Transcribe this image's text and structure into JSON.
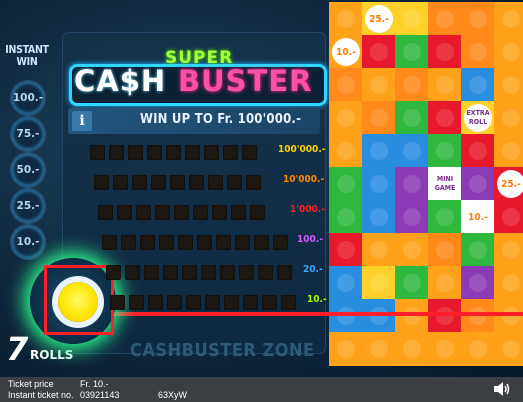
{
  "instant_win": {
    "title_line1": "INSTANT",
    "title_line2": "WIN",
    "values": [
      "100.-",
      "75.-",
      "50.-",
      "25.-",
      "10.-"
    ]
  },
  "logo": {
    "super": "SUPER",
    "cash": "CA$H",
    "buster": "BUSTER"
  },
  "info": {
    "icon": "i",
    "win_up_to": "WIN UP TO Fr. 100'000.-"
  },
  "prizes": [
    {
      "label": "100'000.-",
      "color": "#ffd200"
    },
    {
      "label": "10'000.-",
      "color": "#ff8a00"
    },
    {
      "label": "1'000.-",
      "color": "#ff2020"
    },
    {
      "label": "100.-",
      "color": "#d35bff"
    },
    {
      "label": "20.-",
      "color": "#3aa8ff"
    },
    {
      "label": "10.-",
      "color": "#a8ff00"
    }
  ],
  "zone": "CASHBUSTER ZONE",
  "rolls": {
    "count": "7",
    "label": "ROLLS"
  },
  "grid_tokens": [
    {
      "col": 1,
      "row": 0,
      "text": "25.-"
    },
    {
      "col": 0,
      "row": 1,
      "text": "10.-"
    },
    {
      "col": 4,
      "row": 3,
      "text": "EXTRA ROLL"
    },
    {
      "col": 3,
      "row": 5,
      "text": "MINI GAME"
    },
    {
      "col": 5,
      "row": 5,
      "text": "25.-"
    },
    {
      "col": 4,
      "row": 6,
      "text": "10.-"
    }
  ],
  "grid_colors": [
    [
      "#ffa21a",
      "#ffd12a",
      "#ffd12a",
      "#ff8a1a",
      "#ff8a1a",
      "#ffa21a"
    ],
    [
      "#ffa21a",
      "#e8192c",
      "#2fb83e",
      "#e8192c",
      "#ff8a1a",
      "#ffa21a"
    ],
    [
      "#ff8a1a",
      "#ffa21a",
      "#ff8a1a",
      "#ffa21a",
      "#2a8ee0",
      "#ffa21a"
    ],
    [
      "#ffa21a",
      "#ff8a1a",
      "#2fb83e",
      "#e8192c",
      "#ffd12a",
      "#ffa21a"
    ],
    [
      "#ffa21a",
      "#2a8ee0",
      "#2a8ee0",
      "#2fb83e",
      "#e8192c",
      "#ffa21a"
    ],
    [
      "#2fb83e",
      "#2a8ee0",
      "#8b3bb5",
      "#ffffff",
      "#8b3bb5",
      "#e8192c"
    ],
    [
      "#2fb83e",
      "#2a8ee0",
      "#8b3bb5",
      "#2fb83e",
      "#ffffff",
      "#e8192c"
    ],
    [
      "#e8192c",
      "#ffa21a",
      "#ffa21a",
      "#ff8a1a",
      "#2fb83e",
      "#ffa21a"
    ],
    [
      "#2a8ee0",
      "#ffd12a",
      "#2fb83e",
      "#ffa21a",
      "#8b3bb5",
      "#ffa21a"
    ],
    [
      "#2a8ee0",
      "#2a8ee0",
      "#ffa21a",
      "#e8192c",
      "#ff8a1a",
      "#ffa21a"
    ],
    [
      "#ffa21a",
      "#ffa21a",
      "#ffa21a",
      "#ffa21a",
      "#ffa21a",
      "#ffa21a"
    ]
  ],
  "footer": {
    "ticket_price_label": "Ticket price",
    "ticket_price_value": "Fr. 10.-",
    "ticket_no_label": "Instant ticket no.",
    "ticket_no_value": "03921143",
    "code": "63XyW"
  },
  "icons": {
    "speaker": "speaker-icon",
    "info": "info-icon",
    "ball": "ball"
  }
}
